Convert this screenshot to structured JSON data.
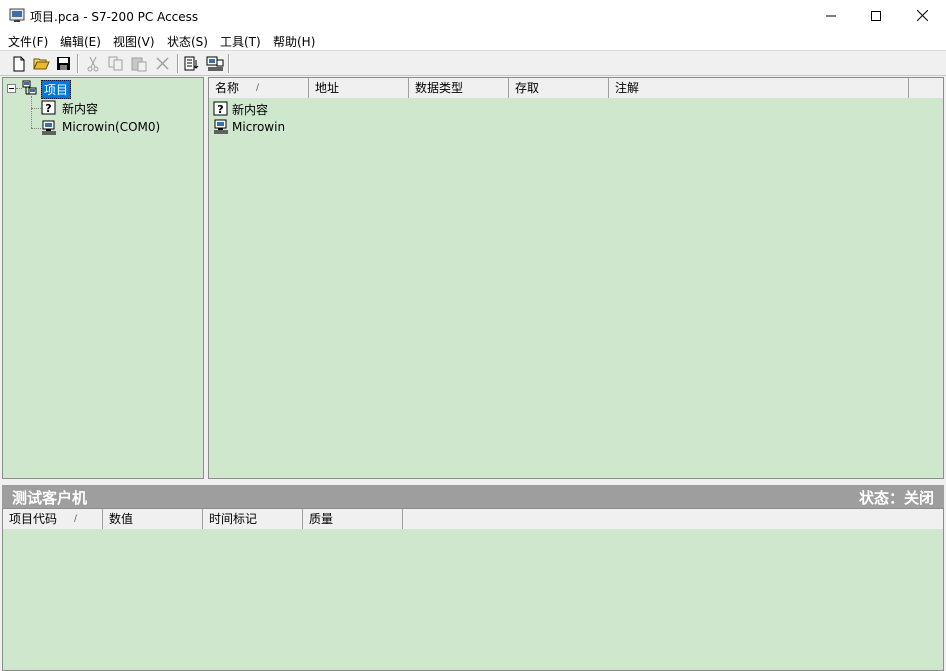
{
  "window": {
    "title": "项目.pca - S7-200 PC Access",
    "icons": {
      "app": "app-icon",
      "minimize": "minimize-icon",
      "maximize": "maximize-icon",
      "close": "close-icon"
    }
  },
  "menu": {
    "items": [
      {
        "label": "文件(F)"
      },
      {
        "label": "编辑(E)"
      },
      {
        "label": "视图(V)"
      },
      {
        "label": "状态(S)"
      },
      {
        "label": "工具(T)"
      },
      {
        "label": "帮助(H)"
      }
    ]
  },
  "toolbar": {
    "buttons": [
      {
        "icon": "new-file-icon",
        "enabled": true
      },
      {
        "icon": "open-folder-icon",
        "enabled": true
      },
      {
        "icon": "save-icon",
        "enabled": true
      },
      {
        "icon": "cut-icon",
        "enabled": false
      },
      {
        "icon": "copy-icon",
        "enabled": false
      },
      {
        "icon": "paste-icon",
        "enabled": false
      },
      {
        "icon": "delete-icon",
        "enabled": false
      },
      {
        "icon": "add-to-client-icon",
        "enabled": true
      },
      {
        "icon": "test-client-icon",
        "enabled": true
      }
    ]
  },
  "tree": {
    "root": {
      "label": "项目",
      "icon": "project-icon",
      "expanded": true,
      "selected": true
    },
    "children": [
      {
        "label": "新内容",
        "icon": "unknown-item-icon"
      },
      {
        "label": "Microwin(COM0)",
        "icon": "plc-icon"
      }
    ]
  },
  "list": {
    "columns": [
      {
        "label": "名称",
        "sorted": true
      },
      {
        "label": "地址"
      },
      {
        "label": "数据类型"
      },
      {
        "label": "存取"
      },
      {
        "label": "注解"
      }
    ],
    "rows": [
      {
        "name": "新内容",
        "icon": "unknown-item-icon"
      },
      {
        "name": "Microwin",
        "icon": "plc-icon"
      }
    ]
  },
  "client": {
    "title": "测试客户机",
    "status": "状态：关闭",
    "columns": [
      {
        "label": "项目代码",
        "sorted": true
      },
      {
        "label": "数值"
      },
      {
        "label": "时间标记"
      },
      {
        "label": "质量"
      }
    ]
  },
  "colors": {
    "pane_bg": "#cfe8cd",
    "selection": "#0078d7",
    "client_title_bg": "#9e9e9e"
  }
}
